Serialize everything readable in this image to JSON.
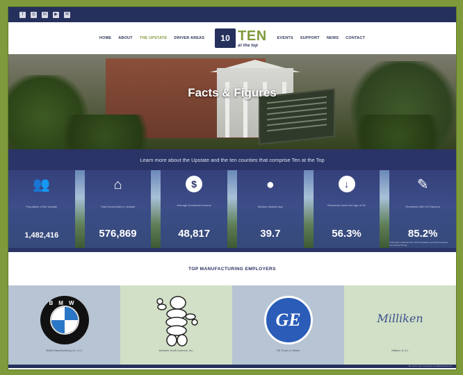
{
  "social_icons": [
    "facebook-icon",
    "instagram-icon",
    "linkedin-icon",
    "youtube-icon",
    "email-icon"
  ],
  "nav": {
    "left_items": [
      "HOME",
      "ABOUT",
      "THE UPSTATE",
      "DRIVER AREAS"
    ],
    "right_items": [
      "EVENTS",
      "SUPPORT",
      "NEWS",
      "CONTACT"
    ],
    "active": "THE UPSTATE",
    "logo": {
      "mark": "10",
      "name": "TEN",
      "tagline": "at the top"
    }
  },
  "hero": {
    "title": "Facts & Figures"
  },
  "stats": {
    "intro": "Learn more about the Upstate and the ten counties that comprise Ten at the Top",
    "items": [
      {
        "icon": "people-icon",
        "label": "Population of the Upstate",
        "value": "1,482,416"
      },
      {
        "icon": "house-icon",
        "label": "Total Households in Upstate",
        "value": "576,869"
      },
      {
        "icon": "dollar-icon",
        "label": "Average Household Income",
        "value": "48,817"
      },
      {
        "icon": "person-icon",
        "label": "Median Upstate Age",
        "value": "39.7"
      },
      {
        "icon": "arrow-down-icon",
        "label": "Residents Under the Age of 45",
        "value": "56.3%"
      },
      {
        "icon": "pencil-icon",
        "label": "Residents With HS Diploma",
        "value": "85.2%"
      }
    ],
    "note": "Information collected from 2013 Population and 2013 American Community Survey"
  },
  "employers": {
    "heading": "TOP MANUFACTURING EMPLOYERS",
    "items": [
      {
        "name": "BMW Manufacturing Co. LLC",
        "logo": "bmw-logo"
      },
      {
        "name": "Michelin North America, Inc.",
        "logo": "michelin-logo"
      },
      {
        "name": "GE Power & Water",
        "logo": "ge-logo"
      },
      {
        "name": "Milliken & Co.",
        "logo": "milliken-logo",
        "wordmark": "Milliken"
      }
    ]
  },
  "footer": {
    "text": "Ten at the Top | Copyright | All Rights Reserved"
  },
  "colors": {
    "navy": "#26305d",
    "green": "#7f9a3b",
    "band": "#2b3467"
  }
}
